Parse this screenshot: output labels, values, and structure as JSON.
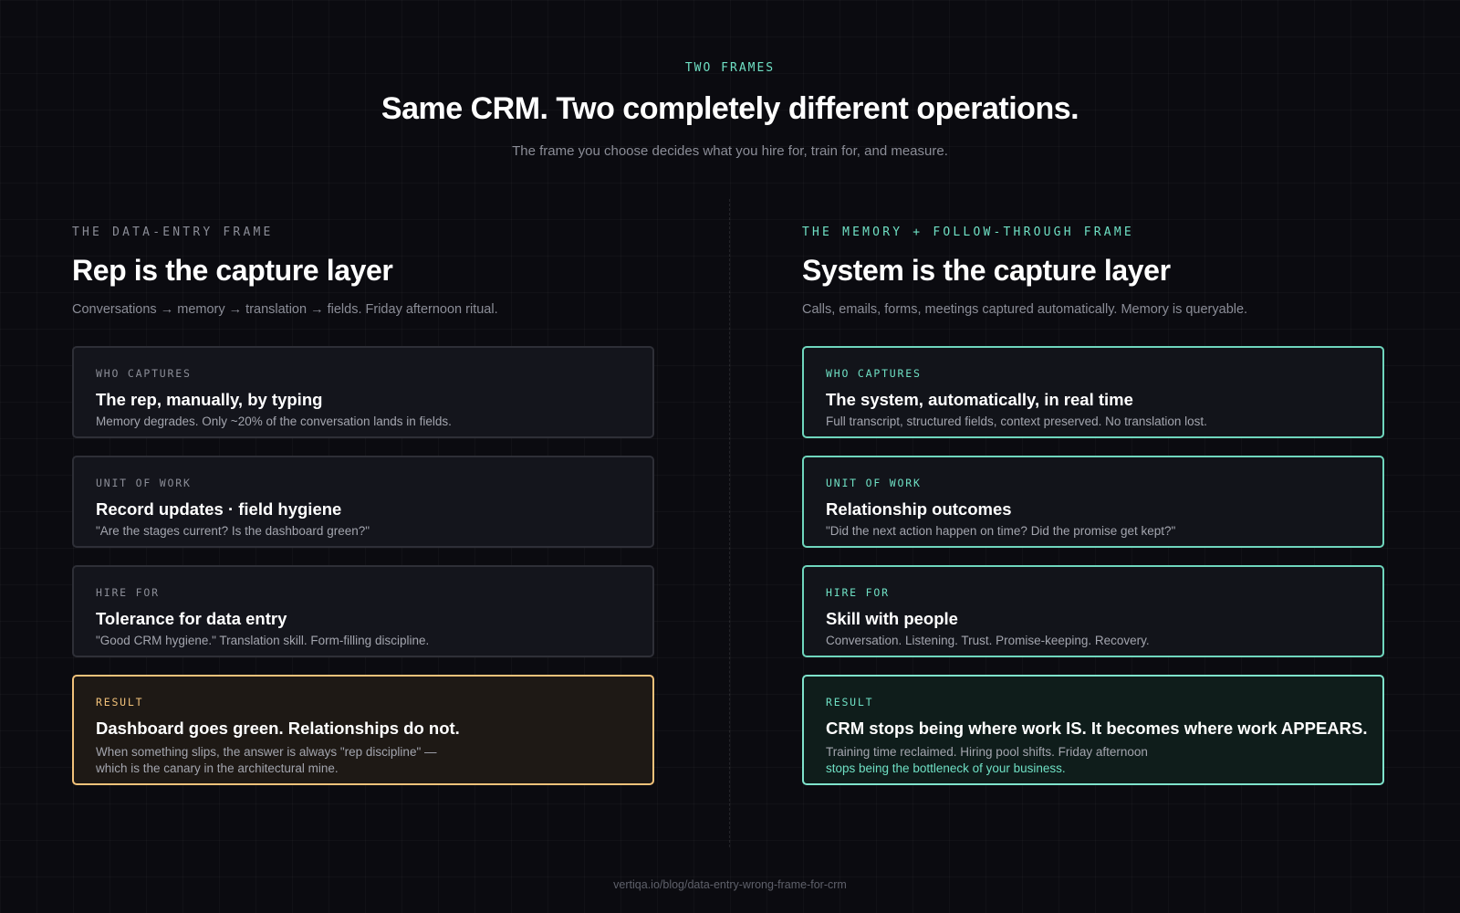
{
  "header": {
    "eyebrow": "TWO FRAMES",
    "title": "Same CRM. Two completely different operations.",
    "subtitle": "The frame you choose decides what you hire for, train for, and measure."
  },
  "left": {
    "label": "THE DATA-ENTRY FRAME",
    "title": "Rep is the capture layer",
    "desc": "Conversations → memory → translation → fields. Friday afternoon ritual.",
    "cards": [
      {
        "label": "WHO CAPTURES",
        "title": "The rep, manually, by typing",
        "desc": "Memory degrades. Only ~20% of the conversation lands in fields."
      },
      {
        "label": "UNIT OF WORK",
        "title": "Record updates · field hygiene",
        "desc": "\"Are the stages current? Is the dashboard green?\""
      },
      {
        "label": "HIRE FOR",
        "title": "Tolerance for data entry",
        "desc": "\"Good CRM hygiene.\" Translation skill. Form-filling discipline."
      },
      {
        "label": "RESULT",
        "title": "Dashboard goes green. Relationships do not.",
        "desc_line1": "When something slips, the answer is always \"rep discipline\" —",
        "desc_line2": "which is the canary in the architectural mine."
      }
    ]
  },
  "right": {
    "label": "THE MEMORY + FOLLOW-THROUGH FRAME",
    "title": "System is the capture layer",
    "desc": "Calls, emails, forms, meetings captured automatically. Memory is queryable.",
    "cards": [
      {
        "label": "WHO CAPTURES",
        "title": "The system, automatically, in real time",
        "desc": "Full transcript, structured fields, context preserved. No translation lost."
      },
      {
        "label": "UNIT OF WORK",
        "title": "Relationship outcomes",
        "desc": "\"Did the next action happen on time? Did the promise get kept?\""
      },
      {
        "label": "HIRE FOR",
        "title": "Skill with people",
        "desc": "Conversation. Listening. Trust. Promise-keeping. Recovery."
      },
      {
        "label": "RESULT",
        "title": "CRM stops being where work IS. It becomes where work APPEARS.",
        "desc_line1": "Training time reclaimed. Hiring pool shifts. Friday afternoon",
        "desc_line2": "stops being the bottleneck of your business."
      }
    ]
  },
  "footer": {
    "source": "vertiqa.io/blog/data-entry-wrong-frame-for-crm"
  },
  "colors": {
    "background": "#0b0b10",
    "accent_teal": "#6fe0c4",
    "accent_amber": "#f2c27a",
    "muted_text": "#8b8d97"
  }
}
